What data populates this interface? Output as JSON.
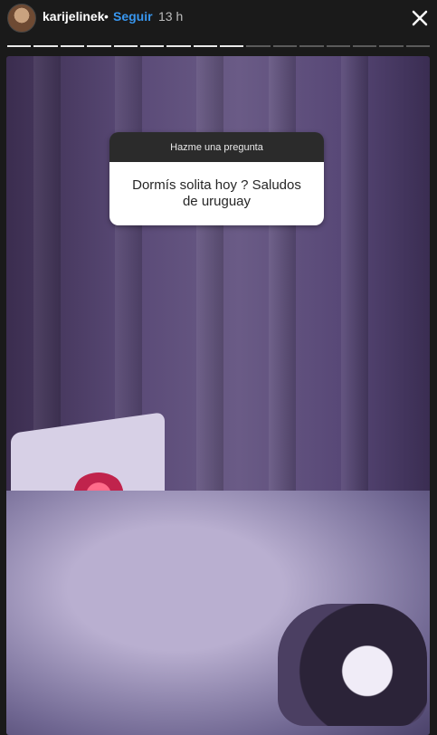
{
  "header": {
    "username": "karijelinek",
    "separator": "•",
    "follow_label": "Seguir",
    "time": "13 h",
    "close_icon": "close-icon"
  },
  "progress": {
    "segments_total": 16,
    "segments_done": 9
  },
  "sticker": {
    "title": "Hazme una pregunta",
    "question": "Dormís solita hoy ? Saludos de uruguay"
  },
  "colors": {
    "follow": "#3897f0",
    "sticker_header": "#2b2b2b",
    "sticker_body": "#ffffff"
  }
}
